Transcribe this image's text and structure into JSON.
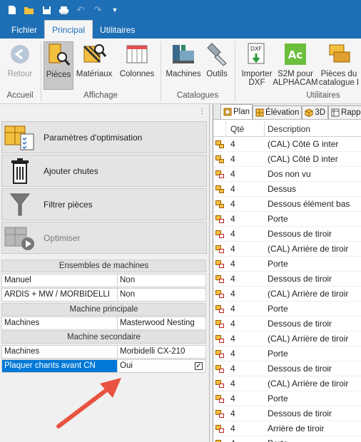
{
  "quick_access": {
    "icons": [
      "new-document-icon",
      "open-folder-icon",
      "save-icon",
      "print-icon",
      "undo-icon",
      "redo-icon",
      "customize-icon"
    ]
  },
  "ribbon": {
    "tabs": [
      {
        "label": "Fichier",
        "active": false
      },
      {
        "label": "Principal",
        "active": true
      },
      {
        "label": "Utilitaires",
        "active": false
      }
    ],
    "groups": [
      {
        "label": "Accueil"
      },
      {
        "label": "Affichage"
      },
      {
        "label": "Catalogues"
      },
      {
        "label": "Utilitaires"
      }
    ],
    "buttons": {
      "retour": "Retour",
      "pieces": "Pièces",
      "materiaux": "Matériaux",
      "colonnes": "Colonnes",
      "machines": "Machines",
      "outils": "Outils",
      "importer_line1": "Importer",
      "importer_line2": "DXF",
      "s2m_line1": "S2M pour",
      "s2m_line2": "ALPHACAM",
      "catalogue_line1": "Pièces du",
      "catalogue_line2": "catalogue I"
    },
    "icon_text": {
      "dxf": "DXF",
      "ac": "Ac"
    }
  },
  "left_panel": {
    "actions": [
      {
        "label": "Paramètres d'optimisation",
        "enabled": true
      },
      {
        "label": "Ajouter chutes",
        "enabled": true
      },
      {
        "label": "Filtrer pièces",
        "enabled": true
      },
      {
        "label": "Optimiser",
        "enabled": false
      }
    ],
    "sections": {
      "ensembles": "Ensembles de machines",
      "principale": "Machine principale",
      "secondaire": "Machine secondaire"
    },
    "ensembles_rows": [
      {
        "key": "Manuel",
        "value": "Non"
      },
      {
        "key": "ARDIS + MW / MORBIDELLI",
        "value": "Non"
      }
    ],
    "principale_rows": [
      {
        "key": "Machines",
        "value": "Masterwood Nesting"
      }
    ],
    "secondaire_rows": [
      {
        "key": "Machines",
        "value": "Morbidelli CX-210"
      },
      {
        "key": "Plaquer chants avant CN",
        "value": "Oui",
        "checked": true,
        "selected": true
      }
    ]
  },
  "right_panel": {
    "view_tabs": [
      {
        "label": "Plan"
      },
      {
        "label": "Élévation"
      },
      {
        "label": "3D"
      },
      {
        "label": "Rappo"
      }
    ],
    "columns": {
      "qty": "Qté",
      "description": "Description"
    },
    "rows": [
      {
        "qty": "4",
        "description": "(CAL) Côté G inter",
        "icon": "yellow"
      },
      {
        "qty": "4",
        "description": "(CAL) Côté D inter",
        "icon": "yellow"
      },
      {
        "qty": "4",
        "description": "Dos non vu",
        "icon": "red"
      },
      {
        "qty": "4",
        "description": "Dessus",
        "icon": "yellow"
      },
      {
        "qty": "4",
        "description": "Dessous élément bas",
        "icon": "yellow"
      },
      {
        "qty": "4",
        "description": "Porte",
        "icon": "red"
      },
      {
        "qty": "4",
        "description": "Dessous de tiroir",
        "icon": "red"
      },
      {
        "qty": "4",
        "description": "(CAL) Arrière de tiroir",
        "icon": "red"
      },
      {
        "qty": "4",
        "description": "Porte",
        "icon": "red"
      },
      {
        "qty": "4",
        "description": "Dessous de tiroir",
        "icon": "red"
      },
      {
        "qty": "4",
        "description": "(CAL) Arrière de tiroir",
        "icon": "red"
      },
      {
        "qty": "4",
        "description": "Porte",
        "icon": "red"
      },
      {
        "qty": "4",
        "description": "Dessous de tiroir",
        "icon": "red"
      },
      {
        "qty": "4",
        "description": "(CAL) Arrière de tiroir",
        "icon": "red"
      },
      {
        "qty": "4",
        "description": "Porte",
        "icon": "red"
      },
      {
        "qty": "4",
        "description": "Dessous de tiroir",
        "icon": "red"
      },
      {
        "qty": "4",
        "description": "(CAL) Arrière de tiroir",
        "icon": "red"
      },
      {
        "qty": "4",
        "description": "Porte",
        "icon": "red"
      },
      {
        "qty": "4",
        "description": "Dessous de tiroir",
        "icon": "red"
      },
      {
        "qty": "4",
        "description": "Arrière de tiroir",
        "icon": "red"
      },
      {
        "qty": "4",
        "description": "Porte",
        "icon": "red"
      }
    ]
  },
  "colors": {
    "brand_blue": "#1e6fb5",
    "selection_blue": "#0078d7",
    "annotation_arrow": "#e8533f"
  }
}
